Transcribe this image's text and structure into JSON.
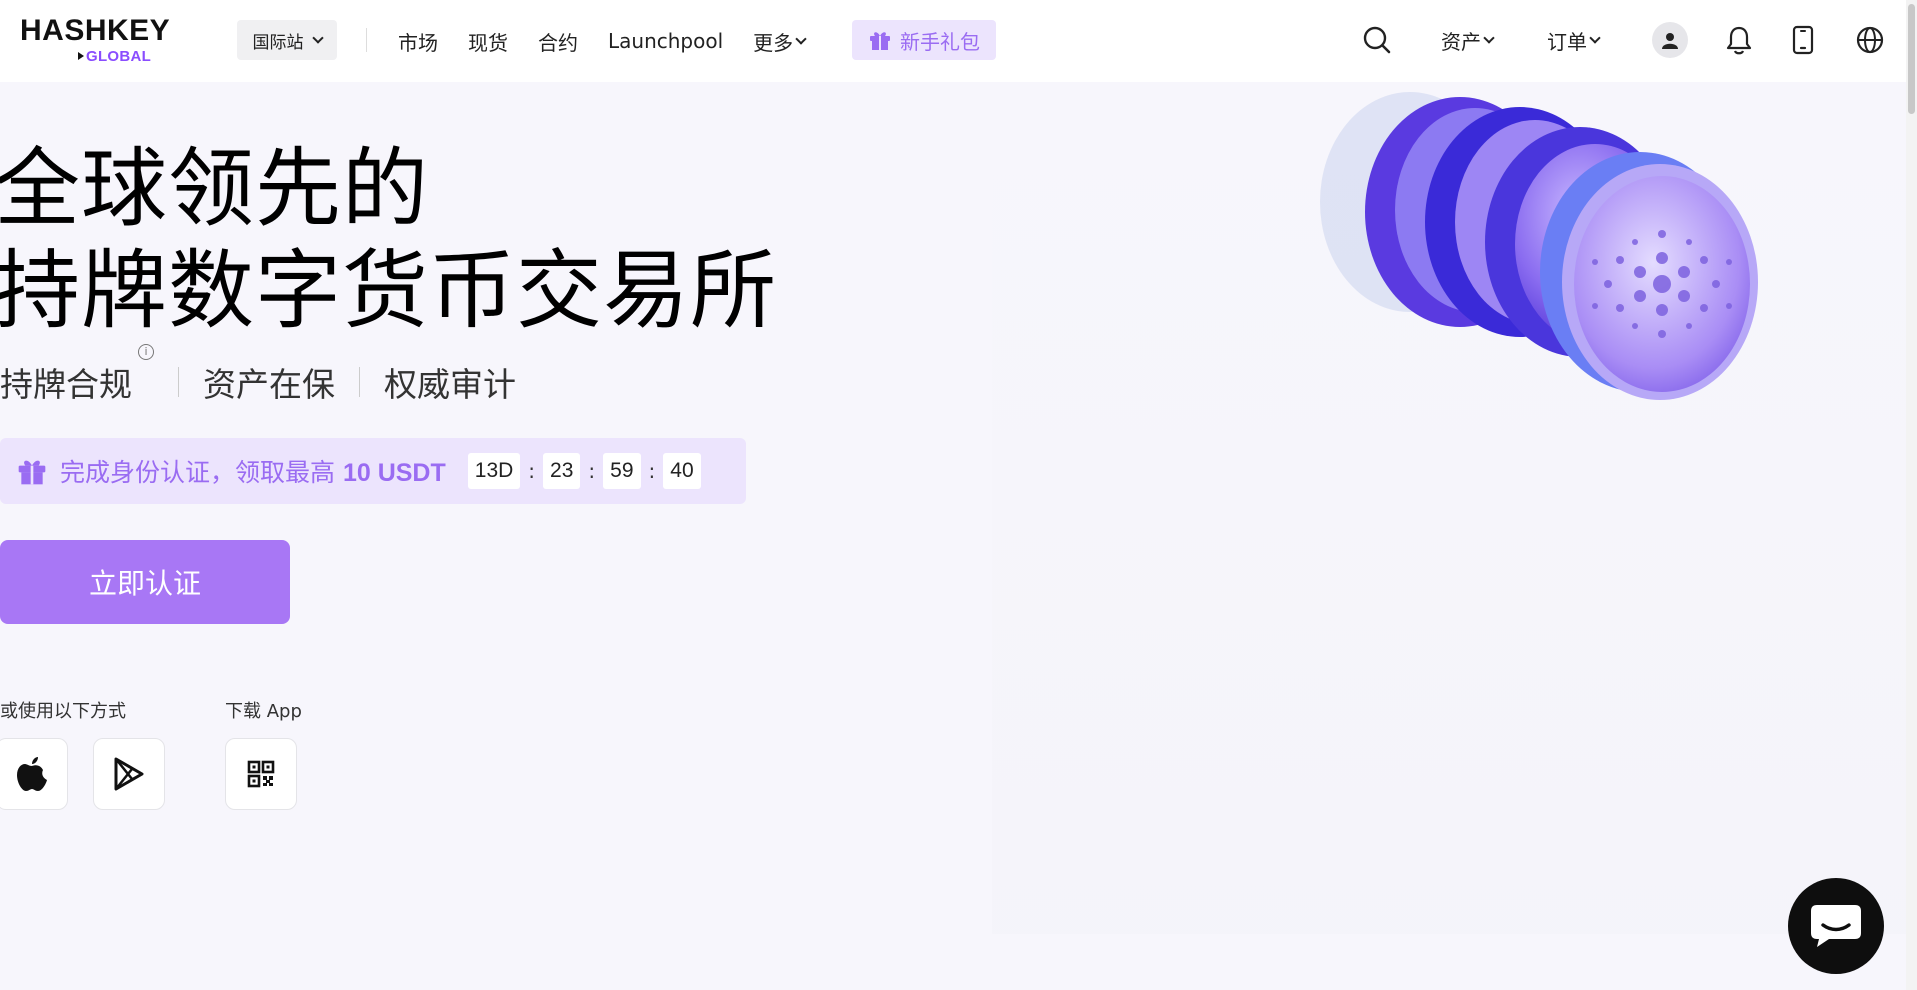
{
  "header": {
    "logo": {
      "main": "HASHKEY",
      "sub": "GLOBAL"
    },
    "site_select": "国际站",
    "nav": [
      {
        "label": "市场"
      },
      {
        "label": "现货"
      },
      {
        "label": "合约"
      },
      {
        "label": "Launchpool"
      },
      {
        "label": "更多"
      }
    ],
    "gift_label": "新手礼包",
    "right": {
      "assets_label": "资产",
      "orders_label": "订单"
    }
  },
  "hero": {
    "title_line1": "全球领先的",
    "title_line2": "持牌数字货币交易所",
    "features": [
      "持牌合规",
      "资产在保",
      "权威审计"
    ],
    "promo": {
      "text_prefix": "完成身份认证，领取最高 ",
      "text_amount": "10 USDT",
      "timer": {
        "days": "13D",
        "hours": "23",
        "minutes": "59",
        "seconds": "40"
      }
    },
    "cta_label": "立即认证",
    "signup_other_label": "或使用以下方式",
    "download_label": "下载 App"
  },
  "colors": {
    "accent": "#a877f5",
    "accent_light": "#ece4fd",
    "accent_text": "#9a6cf2",
    "background": "#f7f6fc"
  }
}
